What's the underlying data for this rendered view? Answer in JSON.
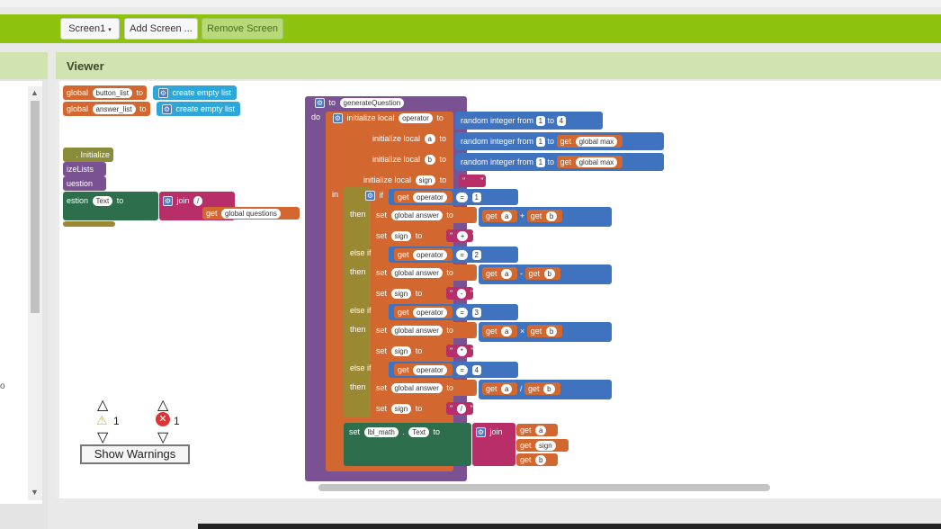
{
  "toolbar": {
    "screen_label": "Screen1",
    "add_screen_label": "Add Screen ...",
    "remove_screen_label": "Remove Screen"
  },
  "viewer": {
    "title": "Viewer"
  },
  "globals": [
    {
      "keyword": "global",
      "name": "button_list",
      "to": "to",
      "value": "create empty list"
    },
    {
      "keyword": "global",
      "name": "answer_list",
      "to": "to",
      "value": "create empty list"
    }
  ],
  "left_blocks": {
    "initialize": ". Initialize",
    "ize_lists": "izeLists",
    "question": "uestion",
    "set_row": {
      "comp": "estion",
      "prop": "Text",
      "to": "to",
      "join": "join",
      "str": "/",
      "get": "get",
      "getvar": "global questions"
    }
  },
  "procedure": {
    "to": "to",
    "name": "generateQuestion",
    "do": "do",
    "in": "in",
    "inits": [
      {
        "label": "initialize local",
        "var": "operator",
        "to": "to",
        "func": "random integer from",
        "from": "1",
        "mid": "to",
        "end": "4"
      },
      {
        "label": "initialize local",
        "var": "a",
        "to": "to",
        "func": "random integer from",
        "from": "1",
        "mid": "to",
        "get": "get",
        "end": "global max"
      },
      {
        "label": "initialize local",
        "var": "b",
        "to": "to",
        "func": "random integer from",
        "from": "1",
        "mid": "to",
        "get": "get",
        "end": "global max"
      },
      {
        "label": "initialize local",
        "var": "sign",
        "to": "to",
        "str": ""
      }
    ],
    "branches": [
      {
        "kw": "if",
        "get": "get",
        "var": "operator",
        "op": "=",
        "num": "1",
        "then": "then",
        "set": "set",
        "setvar": "global answer",
        "to": "to",
        "ga": "a",
        "arith": "+",
        "gb": "b",
        "sign_var": "sign",
        "sign_str": "+"
      },
      {
        "kw": "else if",
        "get": "get",
        "var": "operator",
        "op": "=",
        "num": "2",
        "then": "then",
        "set": "set",
        "setvar": "global answer",
        "to": "to",
        "ga": "a",
        "arith": "-",
        "gb": "b",
        "sign_var": "sign",
        "sign_str": "-"
      },
      {
        "kw": "else if",
        "get": "get",
        "var": "operator",
        "op": "=",
        "num": "3",
        "then": "then",
        "set": "set",
        "setvar": "global answer",
        "to": "to",
        "ga": "a",
        "arith": "×",
        "gb": "b",
        "sign_var": "sign",
        "sign_str": "*"
      },
      {
        "kw": "else if",
        "get": "get",
        "var": "operator",
        "op": "=",
        "num": "4",
        "then": "then",
        "set": "set",
        "setvar": "global answer",
        "to": "to",
        "ga": "a",
        "arith": "/",
        "gb": "b",
        "sign_var": "sign",
        "sign_str": "/"
      }
    ],
    "final_set": {
      "set": "set",
      "comp": "lbl_math",
      "prop": "Text",
      "to": "to",
      "join": "join",
      "items": [
        "a",
        "sign",
        "b"
      ],
      "get": "get"
    }
  },
  "warnings": {
    "warn_count": "1",
    "error_count": "1",
    "button_label": "Show Warnings"
  },
  "side_text": "o"
}
